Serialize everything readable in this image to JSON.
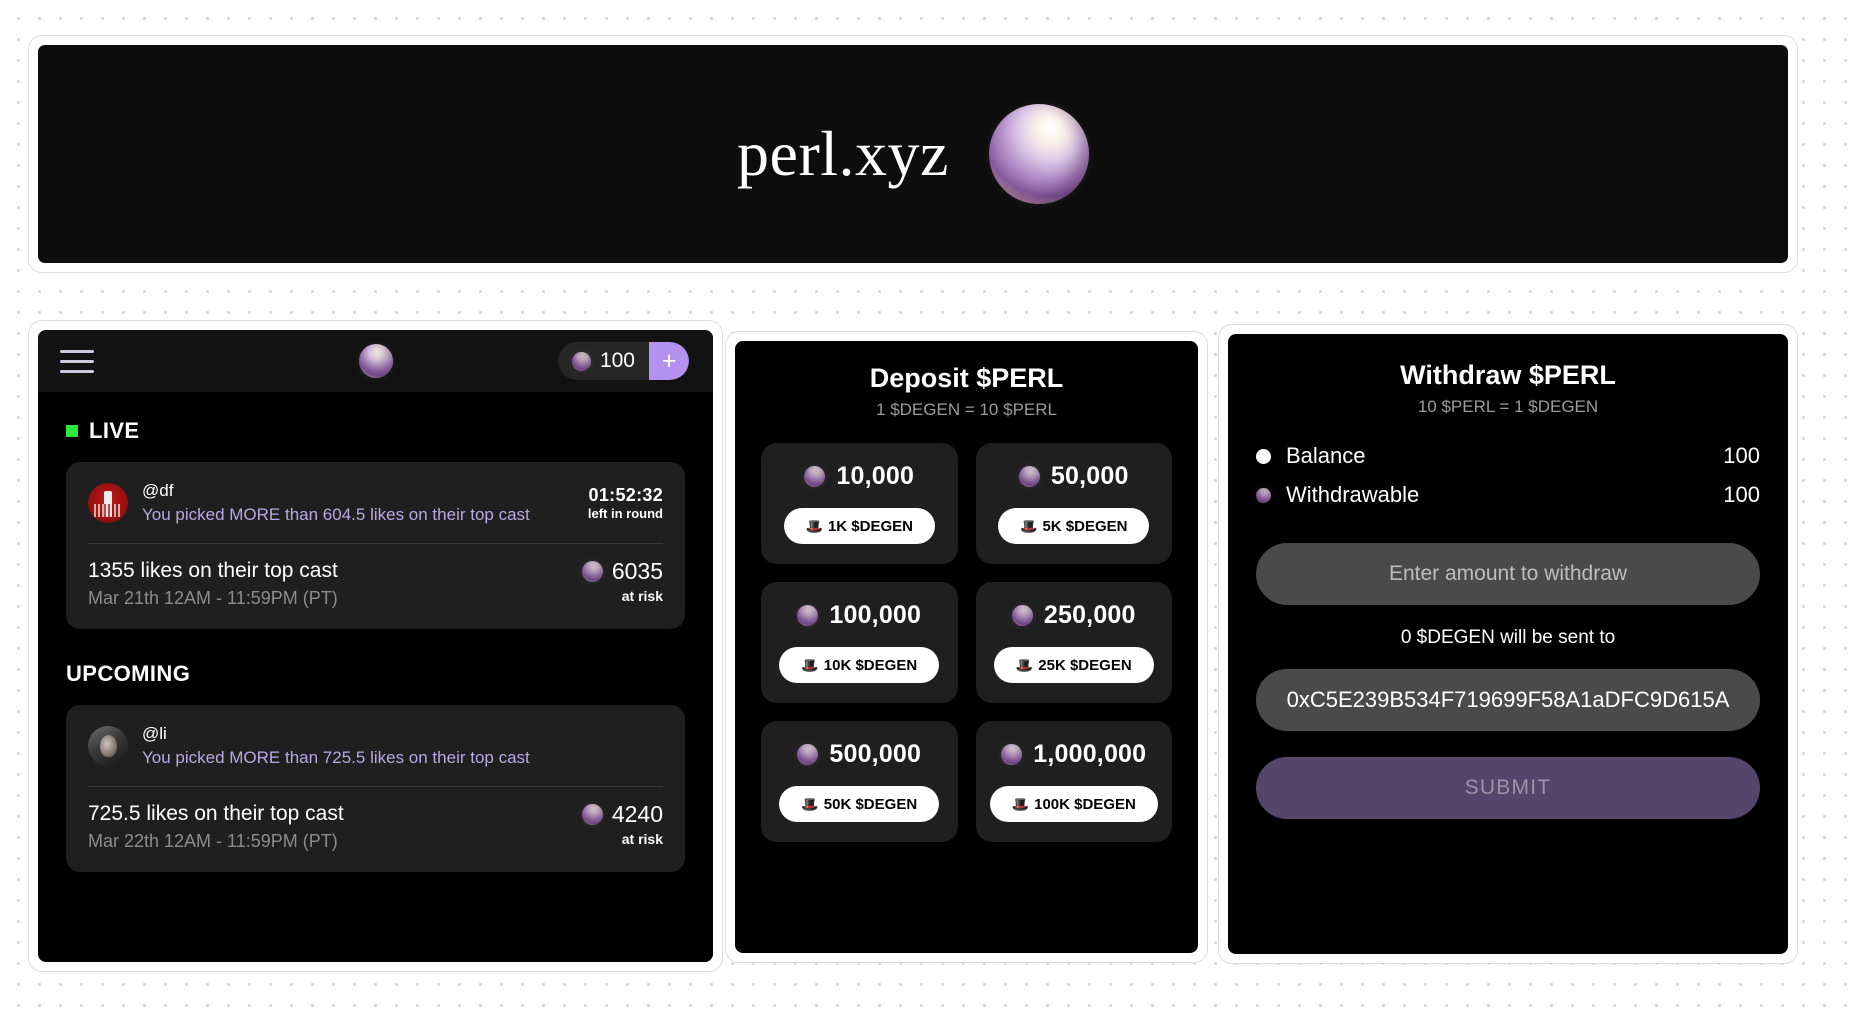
{
  "hero": {
    "title": "perl.xyz",
    "orb_icon": "pearl-orb-icon"
  },
  "feed": {
    "topbar": {
      "menu_icon": "hamburger-menu-icon",
      "logo_icon": "pearl-orb-icon",
      "balance_icon": "pearl-orb-icon",
      "balance": "100",
      "add_label": "+"
    },
    "live_section": {
      "label": "LIVE",
      "status_color": "#2ee83c"
    },
    "upcoming_section": {
      "label": "UPCOMING"
    },
    "live_card": {
      "handle": "@df",
      "pick": "You picked MORE than 604.5 likes on their top cast",
      "timer": "01:52:32",
      "timer_sub": "left in round",
      "bet_title": "1355 likes on their top cast",
      "bet_date": "Mar 21th 12AM - 11:59PM (PT)",
      "risk_amount": "6035",
      "risk_sub": "at risk"
    },
    "upcoming_card": {
      "handle": "@li",
      "pick": "You picked MORE than 725.5 likes on their top cast",
      "bet_title": "725.5 likes on their top cast",
      "bet_date": "Mar 22th 12AM - 11:59PM (PT)",
      "risk_amount": "4240",
      "risk_sub": "at risk"
    }
  },
  "deposit": {
    "title": "Deposit $PERL",
    "rate": "1 $DEGEN = 10 $PERL",
    "tiles": [
      {
        "amount": "10,000",
        "button": "1K $DEGEN",
        "icon": "tophat-icon"
      },
      {
        "amount": "50,000",
        "button": "5K $DEGEN",
        "icon": "tophat-icon"
      },
      {
        "amount": "100,000",
        "button": "10K $DEGEN",
        "icon": "tophat-icon"
      },
      {
        "amount": "250,000",
        "button": "25K $DEGEN",
        "icon": "tophat-icon"
      },
      {
        "amount": "500,000",
        "button": "50K $DEGEN",
        "icon": "tophat-icon"
      },
      {
        "amount": "1,000,000",
        "button": "100K $DEGEN",
        "icon": "tophat-icon"
      }
    ]
  },
  "withdraw": {
    "title": "Withdraw $PERL",
    "rate": "10 $PERL = 1 $DEGEN",
    "balance_label": "Balance",
    "balance_value": "100",
    "withdrawable_label": "Withdrawable",
    "withdrawable_value": "100",
    "amount_placeholder": "Enter amount to withdraw",
    "amount_value": "",
    "note": "0 $DEGEN will be sent to",
    "address": "0xC5E239B534F719699F58A1aDFC9D615A",
    "submit_label": "SUBMIT",
    "accent_color": "#54456b"
  }
}
